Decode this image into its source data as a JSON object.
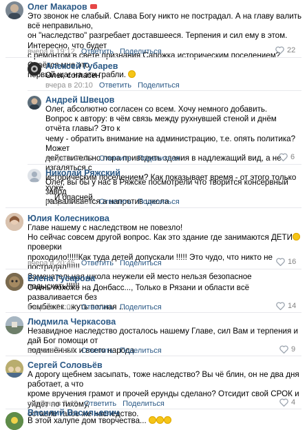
{
  "labels": {
    "reply": "Ответить",
    "share": "Поделиться"
  },
  "comments": [
    {
      "author": "Олег Макаров",
      "text": "Это звонок не слабый. Слава Богу никто не пострадал. А на главу валить всё неправильно,\nон \"наследство\" разгребает доставшееся. Терпения и сил ему в этом. Интересно, что будет\nс ремонтом в свете признания Сапожка историческим поселением? Сдаётся мне это\nпервый шаг на эти грабли.",
      "time": "вчера в 19:12",
      "likes": "22"
    },
    {
      "author": "Алексей Губарев",
      "text": "Олег, согласен",
      "time": "вчера в 20:10",
      "likes": ""
    },
    {
      "author": "Андрей Швецов",
      "text": "Олег, абсолютно согласен со всем. Хочу немного добавить.\nВопрос к автору: в чём связь между рухнувшей стеной и днём отчёта главы? Это к\nчему - обратить внимание на администрацию, т.е. опять политика? Может\nдействительно пора приводить здания в надлежащий вид, а не изгаляться с\nисторическим поселением? Как показывает время - от этого только хуже.\n... И опасней.",
      "time": "вчера в 20:30",
      "likes": "6"
    },
    {
      "author": "Николай Ряжский",
      "text": "Олег, вы бы у нас в Ряжске посмотрели что творится консервный завод\nразваливается а напротив школа",
      "time": "вчера в 20:39",
      "likes": ""
    },
    {
      "author": "Юлия Колесникова",
      "text_a": "Главе нашему с наследством не повезло!\nНо сейчас совсем другой вопрос. Как это здание где занимаются ДЕТИ",
      "text_b": " проверки\nпроходило!!!!!Как туда детей допускали !!!!! Это чудо, что никто не пострадал!!!!!!\nЗамечательная школа неужели ей место нельзя безопасное подыскать!!!!!!",
      "time": "вчера в 20:45",
      "likes": "16"
    },
    {
      "author": "Елена Гусарова",
      "text": "Очень похоже на Донбасс..., Только в Рязани и области всё разваливается без\nбомбёжек...жуть полная ...",
      "time": "вчера в 21:06",
      "likes": "14"
    },
    {
      "author": "Людмила Черкасова",
      "text": "Незавидное наследство досталось нашему Главе, сил Вам и терпения и дай Бог помощи от\nподчинённых и всего народа",
      "time": "вчера в 20:32",
      "likes": "9"
    },
    {
      "author": "Сергей Соловьёв",
      "text": "А дорогу щебнем засыпать, тоже наследство? Вы чё блин, он не два дня работает, а что\nкроме вручения грамот и прочей ерунды сделано? Отсидит свой СРОК и уйдёт по тихому,\nоставив такое же наследство.",
      "time": "сегодня в 7:42",
      "likes": "4"
    },
    {
      "author": "Василий Васильевич",
      "text": "В этой халупе дом творчества...",
      "time": "",
      "likes": ""
    }
  ]
}
